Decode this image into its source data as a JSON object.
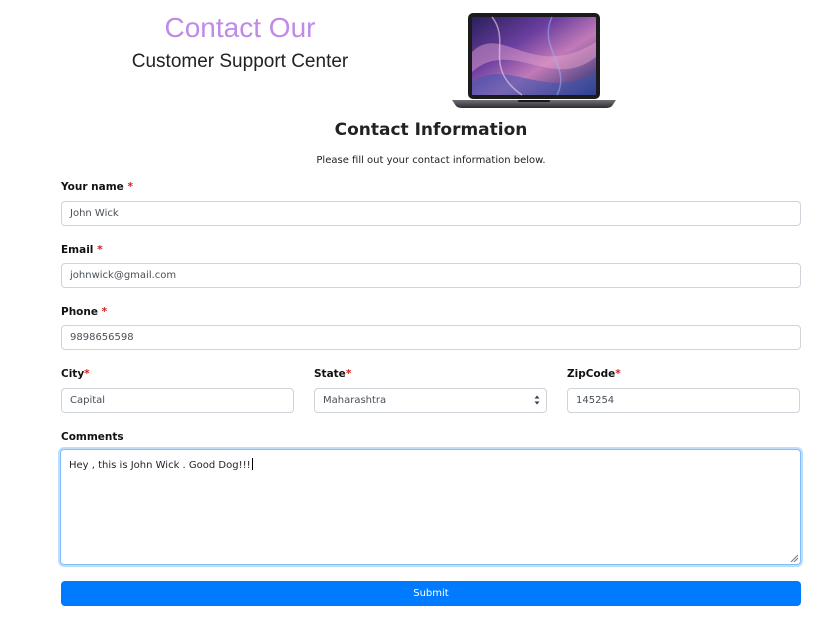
{
  "header": {
    "title": "Contact Our",
    "subtitle": "Customer Support Center"
  },
  "section": {
    "title": "Contact Information",
    "subtitle": "Please fill out your contact information below."
  },
  "form": {
    "required_mark": "*",
    "name": {
      "label": "Your name",
      "value": "John Wick"
    },
    "email": {
      "label": "Email",
      "value": "johnwick@gmail.com"
    },
    "phone": {
      "label": "Phone",
      "value": "9898656598"
    },
    "city": {
      "label": "City",
      "value": "Capital"
    },
    "state": {
      "label": "State",
      "value": "Maharashtra"
    },
    "zipcode": {
      "label": "ZipCode",
      "value": "145254"
    },
    "comments": {
      "label": "Comments",
      "value": "Hey , this is John Wick . Good Dog!!!"
    },
    "submit_label": "Submit"
  },
  "colors": {
    "title_accent": "#c08ae6",
    "primary": "#007bff",
    "required": "#d32020"
  },
  "icons": [
    "laptop-image",
    "select-chevron-icon",
    "resize-grip-icon"
  ]
}
